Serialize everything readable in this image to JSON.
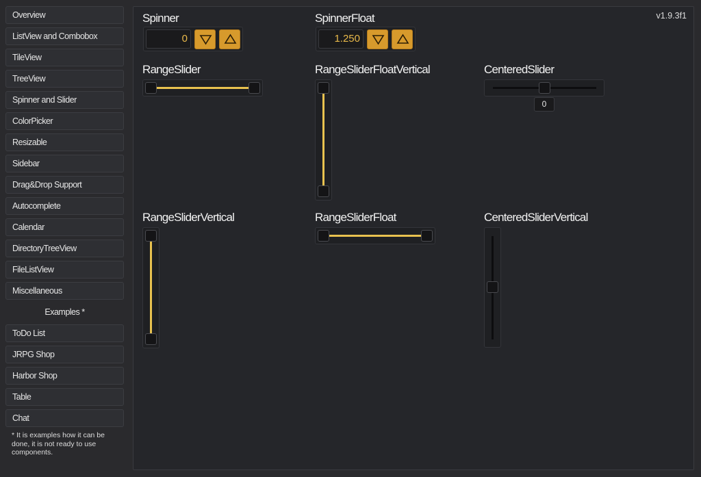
{
  "sidebar": {
    "items": [
      {
        "label": "Overview"
      },
      {
        "label": "ListView and Combobox"
      },
      {
        "label": "TileView"
      },
      {
        "label": "TreeView"
      },
      {
        "label": "Spinner and Slider"
      },
      {
        "label": "ColorPicker"
      },
      {
        "label": "Resizable"
      },
      {
        "label": "Sidebar"
      },
      {
        "label": "Drag&Drop Support"
      },
      {
        "label": "Autocomplete"
      },
      {
        "label": "Calendar"
      },
      {
        "label": "DirectoryTreeView"
      },
      {
        "label": "FileListView"
      },
      {
        "label": "Miscellaneous"
      }
    ],
    "examples_header": "Examples *",
    "examples": [
      {
        "label": "ToDo List"
      },
      {
        "label": "JRPG Shop"
      },
      {
        "label": "Harbor Shop"
      },
      {
        "label": "Table"
      },
      {
        "label": "Chat"
      }
    ],
    "footnote": "* It is examples how it can be done, it is not ready to use components."
  },
  "main": {
    "version": "v1.9.3f1",
    "spinner": {
      "title": "Spinner",
      "value": "0"
    },
    "spinner_float": {
      "title": "SpinnerFloat",
      "value": "1.250"
    },
    "range_slider": {
      "title": "RangeSlider"
    },
    "range_slider_float_vertical": {
      "title": "RangeSliderFloatVertical"
    },
    "centered_slider": {
      "title": "CenteredSlider",
      "value": "0"
    },
    "range_slider_vertical": {
      "title": "RangeSliderVertical"
    },
    "range_slider_float": {
      "title": "RangeSliderFloat"
    },
    "centered_slider_vertical": {
      "title": "CenteredSliderVertical"
    }
  },
  "colors": {
    "accent": "#d79a2c",
    "track": "#e9c24f",
    "value_text": "#e9b94a"
  }
}
